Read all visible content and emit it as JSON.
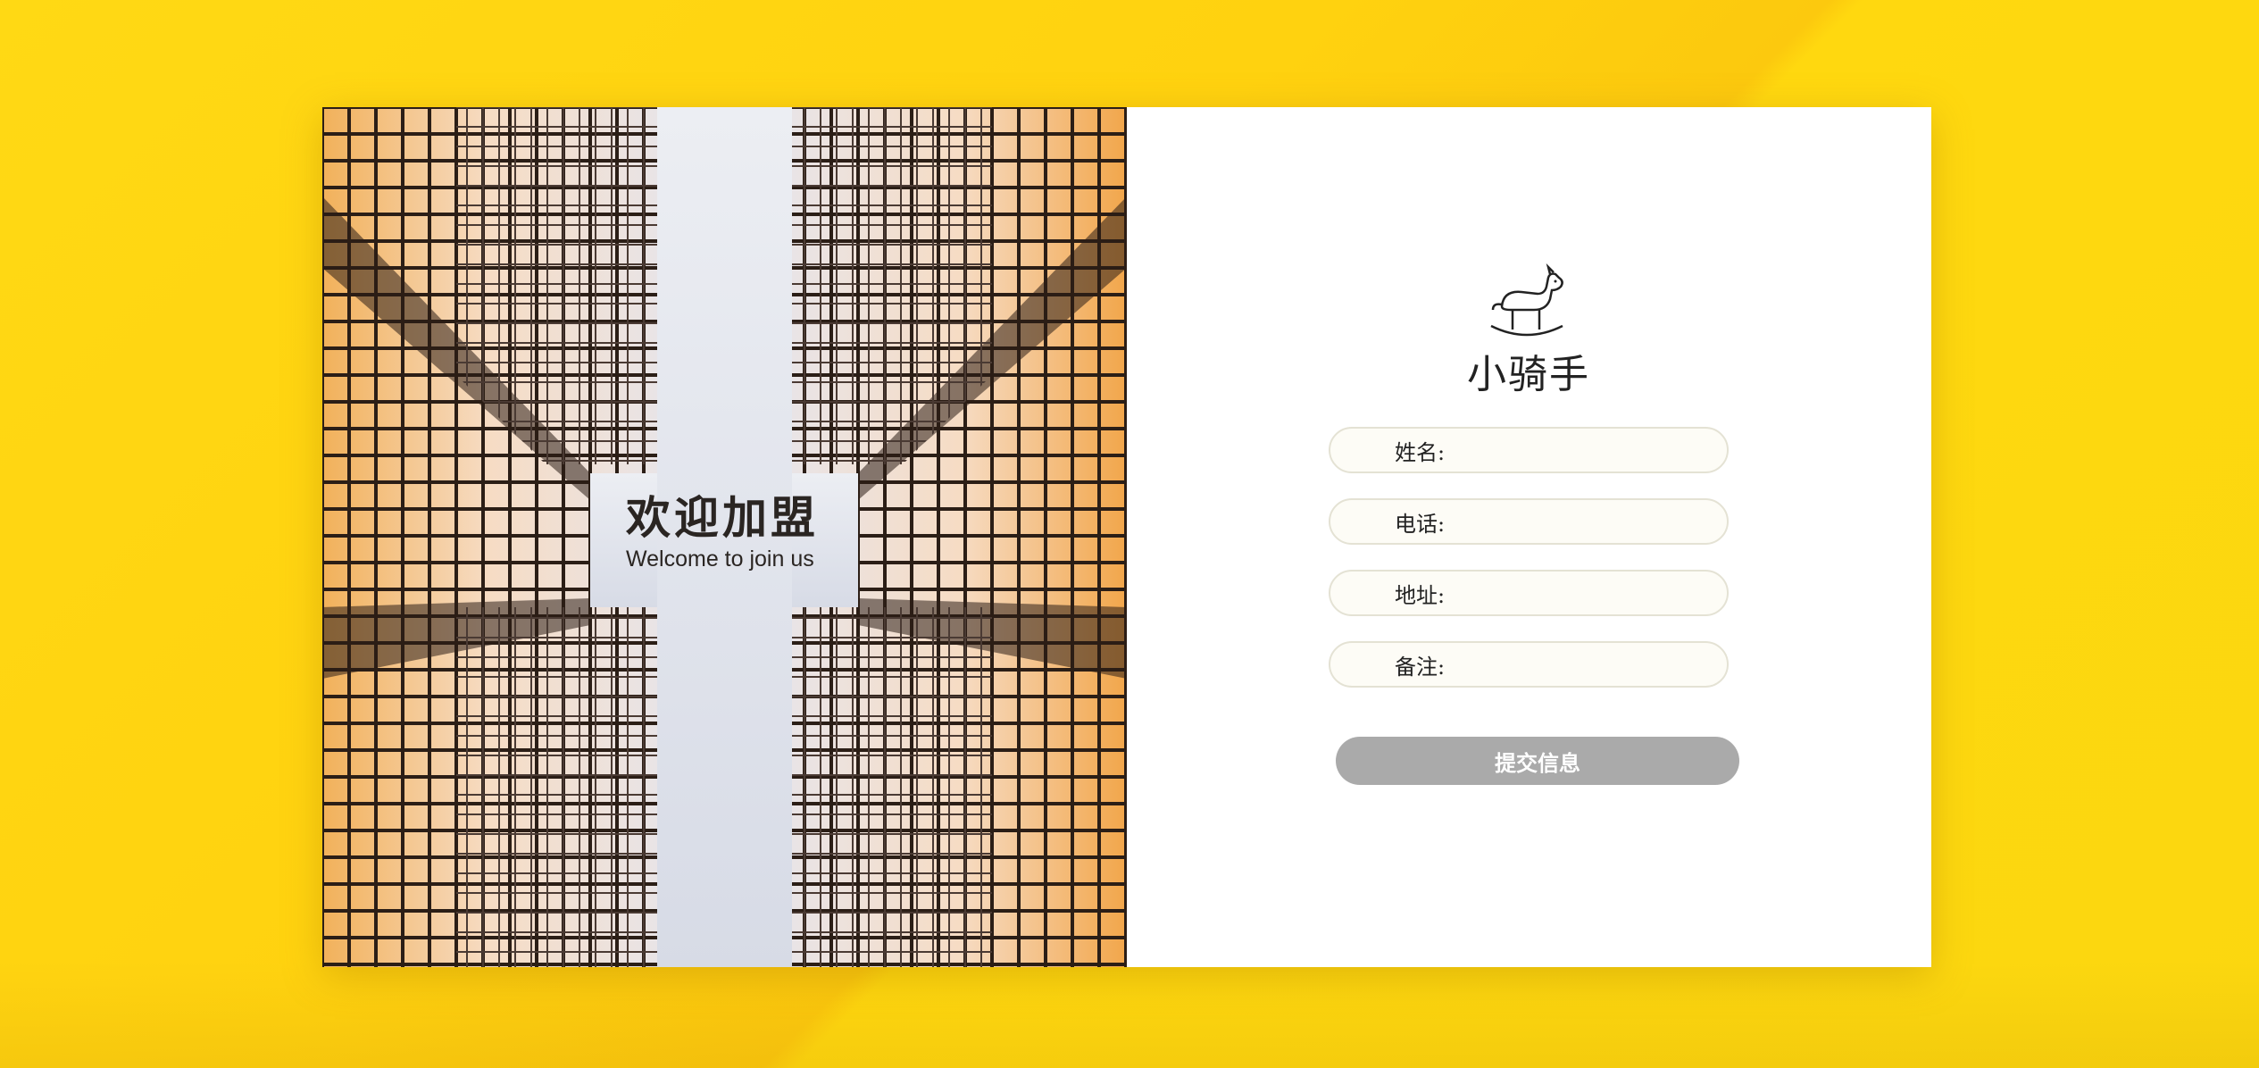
{
  "hero": {
    "title": "欢迎加盟",
    "subtitle": "Welcome to join us"
  },
  "brand": {
    "name": "小骑手",
    "icon": "rocking-horse-icon"
  },
  "form": {
    "fields": [
      {
        "label": "姓名:",
        "value": ""
      },
      {
        "label": "电话:",
        "value": ""
      },
      {
        "label": "地址:",
        "value": ""
      },
      {
        "label": "备注:",
        "value": ""
      }
    ],
    "submit_label": "提交信息"
  },
  "colors": {
    "background": "#ffd60f",
    "card": "#ffffff",
    "field_border": "#e4e2d4",
    "field_bg": "#fdfcf6",
    "submit_bg": "#aaaaaa",
    "submit_text": "#ffffff"
  }
}
